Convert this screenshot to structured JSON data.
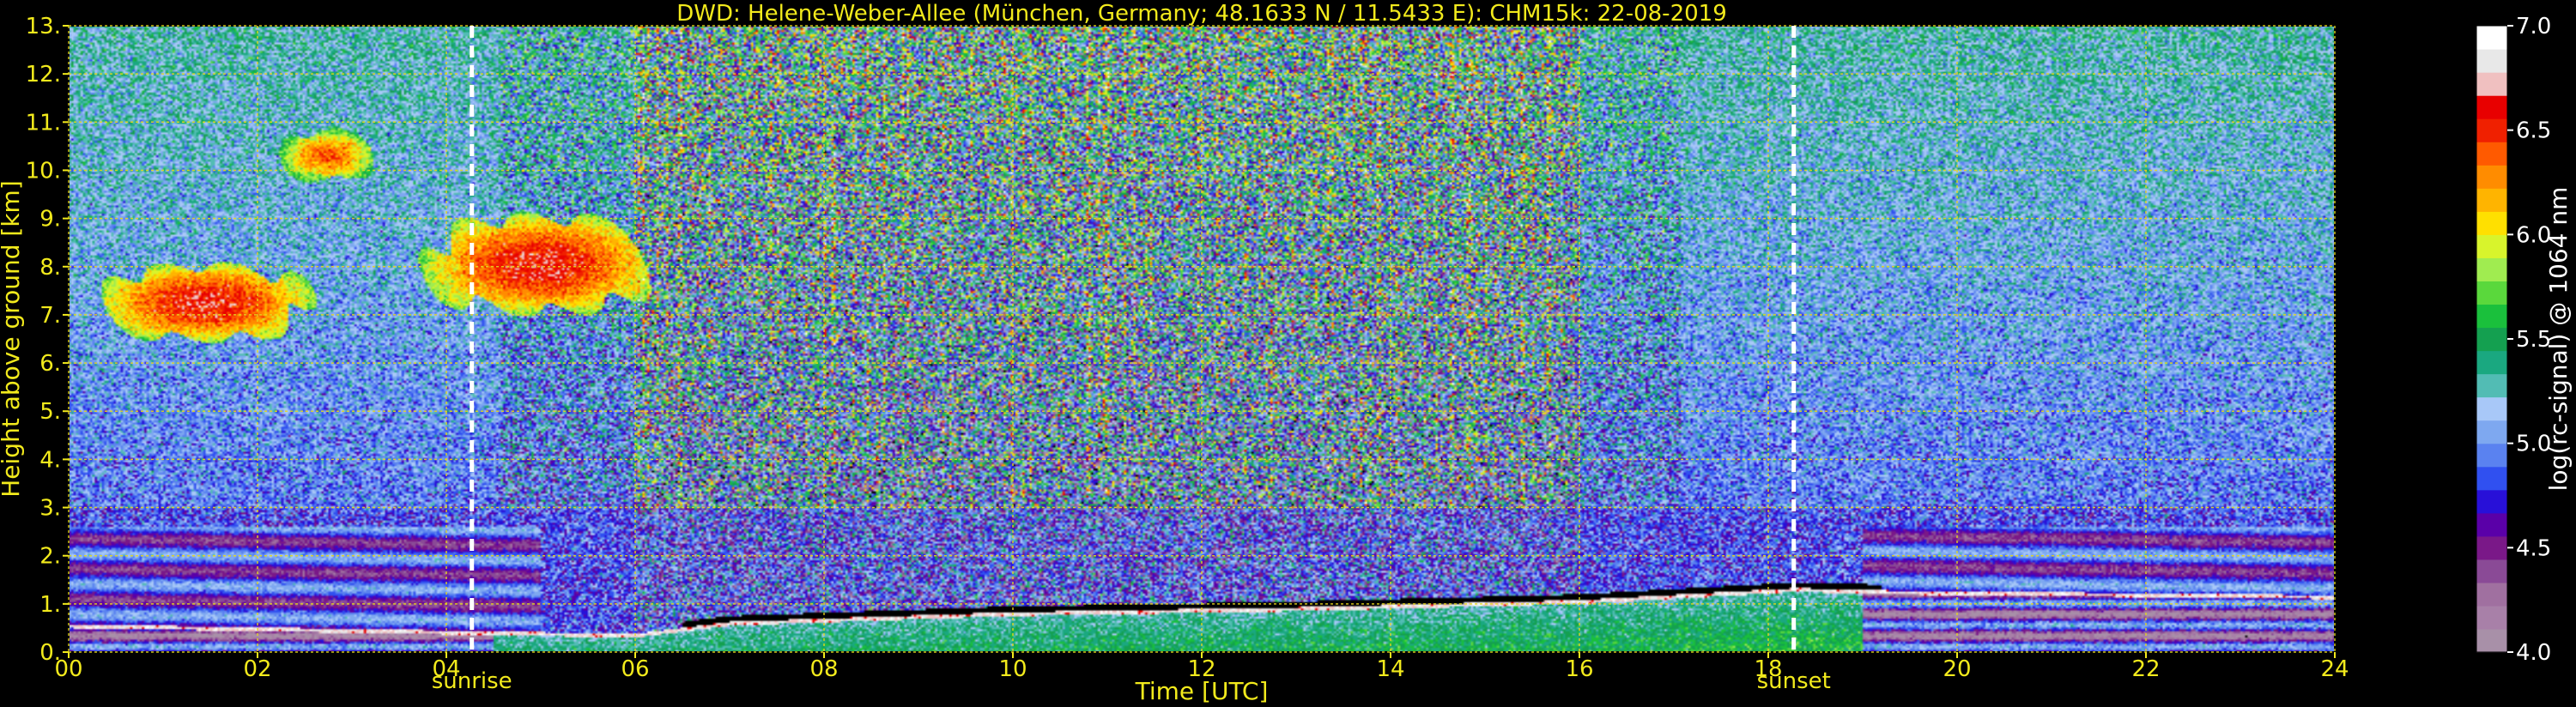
{
  "chart_data": {
    "type": "heatmap",
    "title": "DWD: Helene-Weber-Allee (München, Germany; 48.1633 N / 11.5433 E):    CHM15k: 22-08-2019",
    "xlabel": "Time [UTC]",
    "ylabel": "Height above ground [km]",
    "xlim": [
      0,
      24
    ],
    "ylim": [
      0,
      13
    ],
    "x_ticks": [
      0,
      2,
      4,
      6,
      8,
      10,
      12,
      14,
      16,
      18,
      20,
      22,
      24
    ],
    "x_tick_labels": [
      "00",
      "02",
      "04",
      "06",
      "08",
      "10",
      "12",
      "14",
      "16",
      "18",
      "20",
      "22",
      "24"
    ],
    "y_ticks": [
      0,
      1,
      2,
      3,
      4,
      5,
      6,
      7,
      8,
      9,
      10,
      11,
      12,
      13
    ],
    "y_tick_labels": [
      "0.",
      "1.",
      "2.",
      "3.",
      "4.",
      "5.",
      "6.",
      "7.",
      "8.",
      "9.",
      "10.",
      "11.",
      "12.",
      "13."
    ],
    "grid": true,
    "colorbar": {
      "label": "log(rc-signal) @ 1064 nm",
      "range": [
        4.0,
        7.0
      ],
      "ticks": [
        4.0,
        4.5,
        5.0,
        5.5,
        6.0,
        6.5,
        7.0
      ],
      "tick_labels": [
        "4.0",
        "4.5",
        "5.0",
        "5.5",
        "6.0",
        "6.5",
        "7.0"
      ],
      "colors": [
        "#a890a8",
        "#a880a8",
        "#a070a0",
        "#8a4a96",
        "#7a1888",
        "#5a00a8",
        "#2810d8",
        "#3050f0",
        "#5a82f0",
        "#7ea8f0",
        "#a8c8f8",
        "#52bcb4",
        "#1aa880",
        "#14a050",
        "#1ac03c",
        "#5ad83c",
        "#a0ec50",
        "#d8f42c",
        "#ffe000",
        "#ffb400",
        "#ff8c00",
        "#ff5a00",
        "#f02000",
        "#e80000",
        "#f0c0c0",
        "#e8e8e8",
        "#ffffff"
      ]
    },
    "markers": [
      {
        "x": 4.27,
        "label": "sunrise"
      },
      {
        "x": 18.27,
        "label": "sunset"
      }
    ],
    "features": {
      "boundary_layer_top_km": [
        [
          0,
          0.5
        ],
        [
          6,
          0.3
        ],
        [
          7,
          0.55
        ],
        [
          10,
          0.75
        ],
        [
          13,
          0.85
        ],
        [
          16,
          1.0
        ],
        [
          18.3,
          1.25
        ],
        [
          19.2,
          1.2
        ],
        [
          24,
          1.1
        ]
      ],
      "high_clouds": [
        {
          "t0": 0.0,
          "t1": 2.9,
          "h0": 6.2,
          "h1": 8.3,
          "intensity": 6.6
        },
        {
          "t0": 2.1,
          "t1": 3.4,
          "h0": 9.6,
          "h1": 11.0,
          "intensity": 6.4
        },
        {
          "t0": 3.4,
          "t1": 6.6,
          "h0": 6.7,
          "h1": 9.4,
          "intensity": 6.6
        }
      ]
    }
  }
}
